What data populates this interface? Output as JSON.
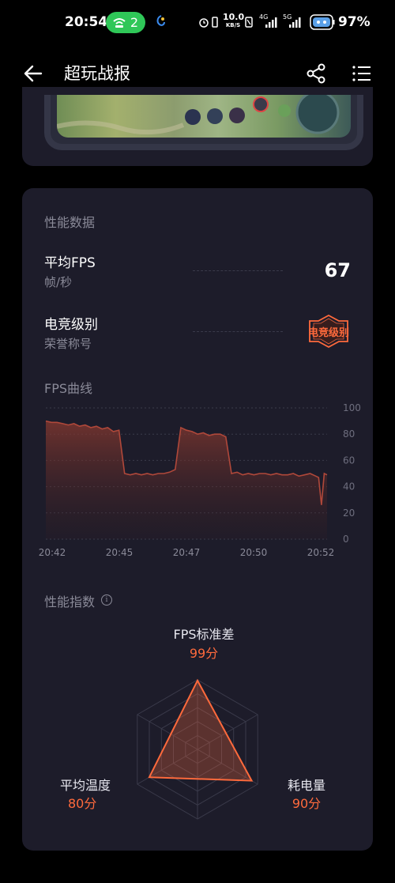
{
  "status_bar": {
    "time": "20:54",
    "hotspot_count": "2",
    "net_speed_value": "10.0",
    "net_speed_unit": "KB/S",
    "signal_1": "4G",
    "signal_2": "5G",
    "battery": "97%"
  },
  "app_bar": {
    "title": "超玩战报",
    "icons": [
      "back-arrow-icon",
      "share-icon",
      "menu-list-icon"
    ]
  },
  "performance": {
    "section_title": "性能数据",
    "avg_fps": {
      "label": "平均FPS",
      "sub": "帧/秒",
      "value": "67"
    },
    "esports_level": {
      "label": "电竞级别",
      "sub": "荣誉称号",
      "badge": "电竞级别"
    }
  },
  "fps_chart": {
    "section_title": "FPS曲线"
  },
  "chart_data": {
    "type": "area",
    "x_ticks": [
      "20:42",
      "20:45",
      "20:47",
      "20:50",
      "20:52"
    ],
    "y_ticks": [
      "100",
      "80",
      "60",
      "40",
      "20",
      "0"
    ],
    "ylim": [
      0,
      100
    ],
    "grid": true,
    "series": [
      {
        "x": [
          0,
          2,
          4,
          6,
          8,
          10,
          12,
          14,
          16,
          18,
          20,
          22,
          24,
          26,
          28,
          30,
          32,
          34,
          36,
          38,
          40,
          42,
          44,
          46,
          48,
          50,
          52,
          54,
          56,
          58,
          60,
          62,
          64,
          66,
          68,
          70,
          72,
          74,
          76,
          78,
          80,
          82,
          84,
          86,
          88,
          90,
          92,
          94,
          96,
          97,
          98,
          99,
          100
        ],
        "values": [
          90,
          89,
          89,
          88,
          87,
          88,
          86,
          87,
          85,
          86,
          84,
          85,
          82,
          83,
          50,
          49,
          50,
          49,
          50,
          49,
          50,
          50,
          51,
          53,
          85,
          83,
          82,
          80,
          81,
          79,
          80,
          80,
          78,
          50,
          51,
          49,
          50,
          49,
          50,
          50,
          49,
          50,
          49,
          49,
          50,
          48,
          49,
          50,
          48,
          47,
          26,
          50,
          49
        ]
      }
    ]
  },
  "performance_index": {
    "section_title": "性能指数",
    "info_icon": "info-icon",
    "axes": [
      {
        "label": "FPS标准差",
        "score": "99分",
        "value": 99
      },
      {
        "label": "耗电量",
        "score": "90分",
        "value": 90
      },
      {
        "label": "平均温度",
        "score": "80分",
        "value": 80
      }
    ],
    "accent": "#ff6a3c"
  },
  "colors": {
    "background": "#000000",
    "card": "#1d1c2a",
    "accent": "#ff6a3c",
    "chart_line": "#b0483a"
  }
}
